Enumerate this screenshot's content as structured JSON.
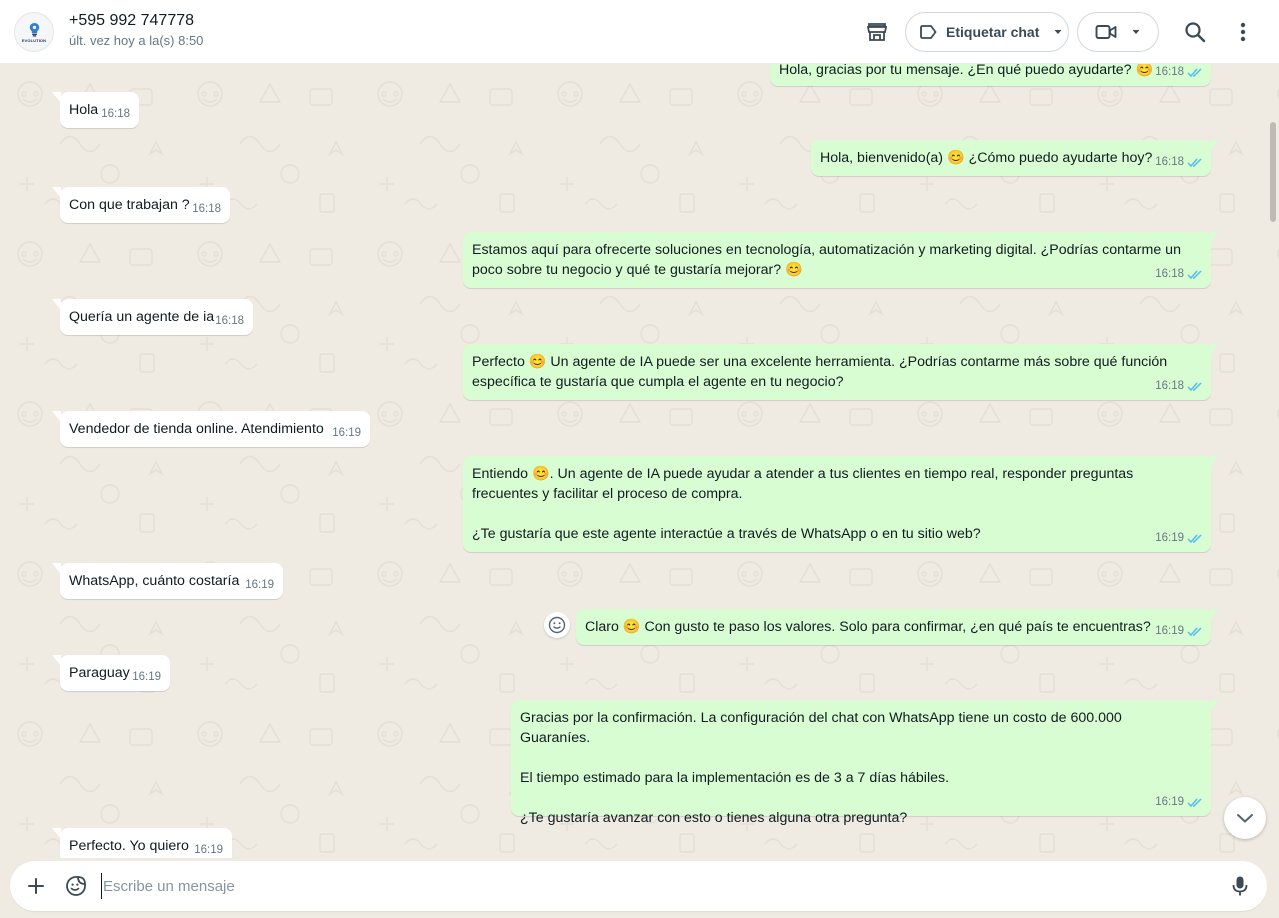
{
  "header": {
    "avatar_text": "EVOLUTION",
    "contact_name": "+595 992 747778",
    "last_seen": "últ. vez hoy a la(s) 8:50",
    "label_button": "Etiquetar chat"
  },
  "messages": [
    {
      "dir": "out",
      "text": "Hola, gracias por tu mensaje. ¿En qué puedo ayudarte? 😊",
      "time": "16:18",
      "status": "read"
    },
    {
      "dir": "in",
      "text": "Hola",
      "time": "16:18"
    },
    {
      "dir": "out",
      "text": "Hola, bienvenido(a) 😊 ¿Cómo puedo ayudarte hoy?",
      "time": "16:18",
      "status": "read"
    },
    {
      "dir": "in",
      "text": "Con que trabajan ?",
      "time": "16:18"
    },
    {
      "dir": "out",
      "text": "Estamos aquí para ofrecerte soluciones en tecnología, automatización y marketing digital. ¿Podrías contarme un poco sobre tu negocio y qué te gustaría mejorar? 😊",
      "time": "16:18",
      "status": "read"
    },
    {
      "dir": "in",
      "text": "Quería un agente de ia",
      "time": "16:18"
    },
    {
      "dir": "out",
      "text": "Perfecto 😊 Un agente de IA puede ser una excelente herramienta. ¿Podrías contarme más sobre qué función específica te gustaría que cumpla el agente en tu negocio?",
      "time": "16:18",
      "status": "read"
    },
    {
      "dir": "in",
      "text": "Vendedor de tienda online. Atendimiento",
      "time": "16:19"
    },
    {
      "dir": "out",
      "text": "Entiendo 😊. Un agente de IA puede ayudar a atender a tus clientes en tiempo real, responder preguntas frecuentes y facilitar el proceso de compra.\n\n¿Te gustaría que este agente interactúe a través de WhatsApp o en tu sitio web?",
      "time": "16:19",
      "status": "read"
    },
    {
      "dir": "in",
      "text": "WhatsApp, cuánto costaría",
      "time": "16:19"
    },
    {
      "dir": "out",
      "text": "Claro 😊 Con gusto te paso los valores. Solo para confirmar, ¿en qué país te encuentras?",
      "time": "16:19",
      "status": "read"
    },
    {
      "dir": "in",
      "text": "Paraguay",
      "time": "16:19"
    },
    {
      "dir": "out",
      "text": "Gracias por la confirmación. La configuración del chat con WhatsApp tiene un costo de 600.000 Guaraníes.\n\nEl tiempo estimado para la implementación es de 3 a 7 días hábiles.\n\n¿Te gustaría avanzar con esto o tienes alguna otra pregunta?",
      "time": "16:19",
      "status": "read"
    },
    {
      "dir": "in",
      "text": "Perfecto. Yo quiero",
      "time": "16:19"
    }
  ],
  "composer": {
    "placeholder": "Escribe un mensaje"
  },
  "colors": {
    "outgoing_bubble": "#d9fdd3",
    "incoming_bubble": "#ffffff",
    "chat_background": "#efeae2",
    "read_ticks": "#53bdeb"
  }
}
